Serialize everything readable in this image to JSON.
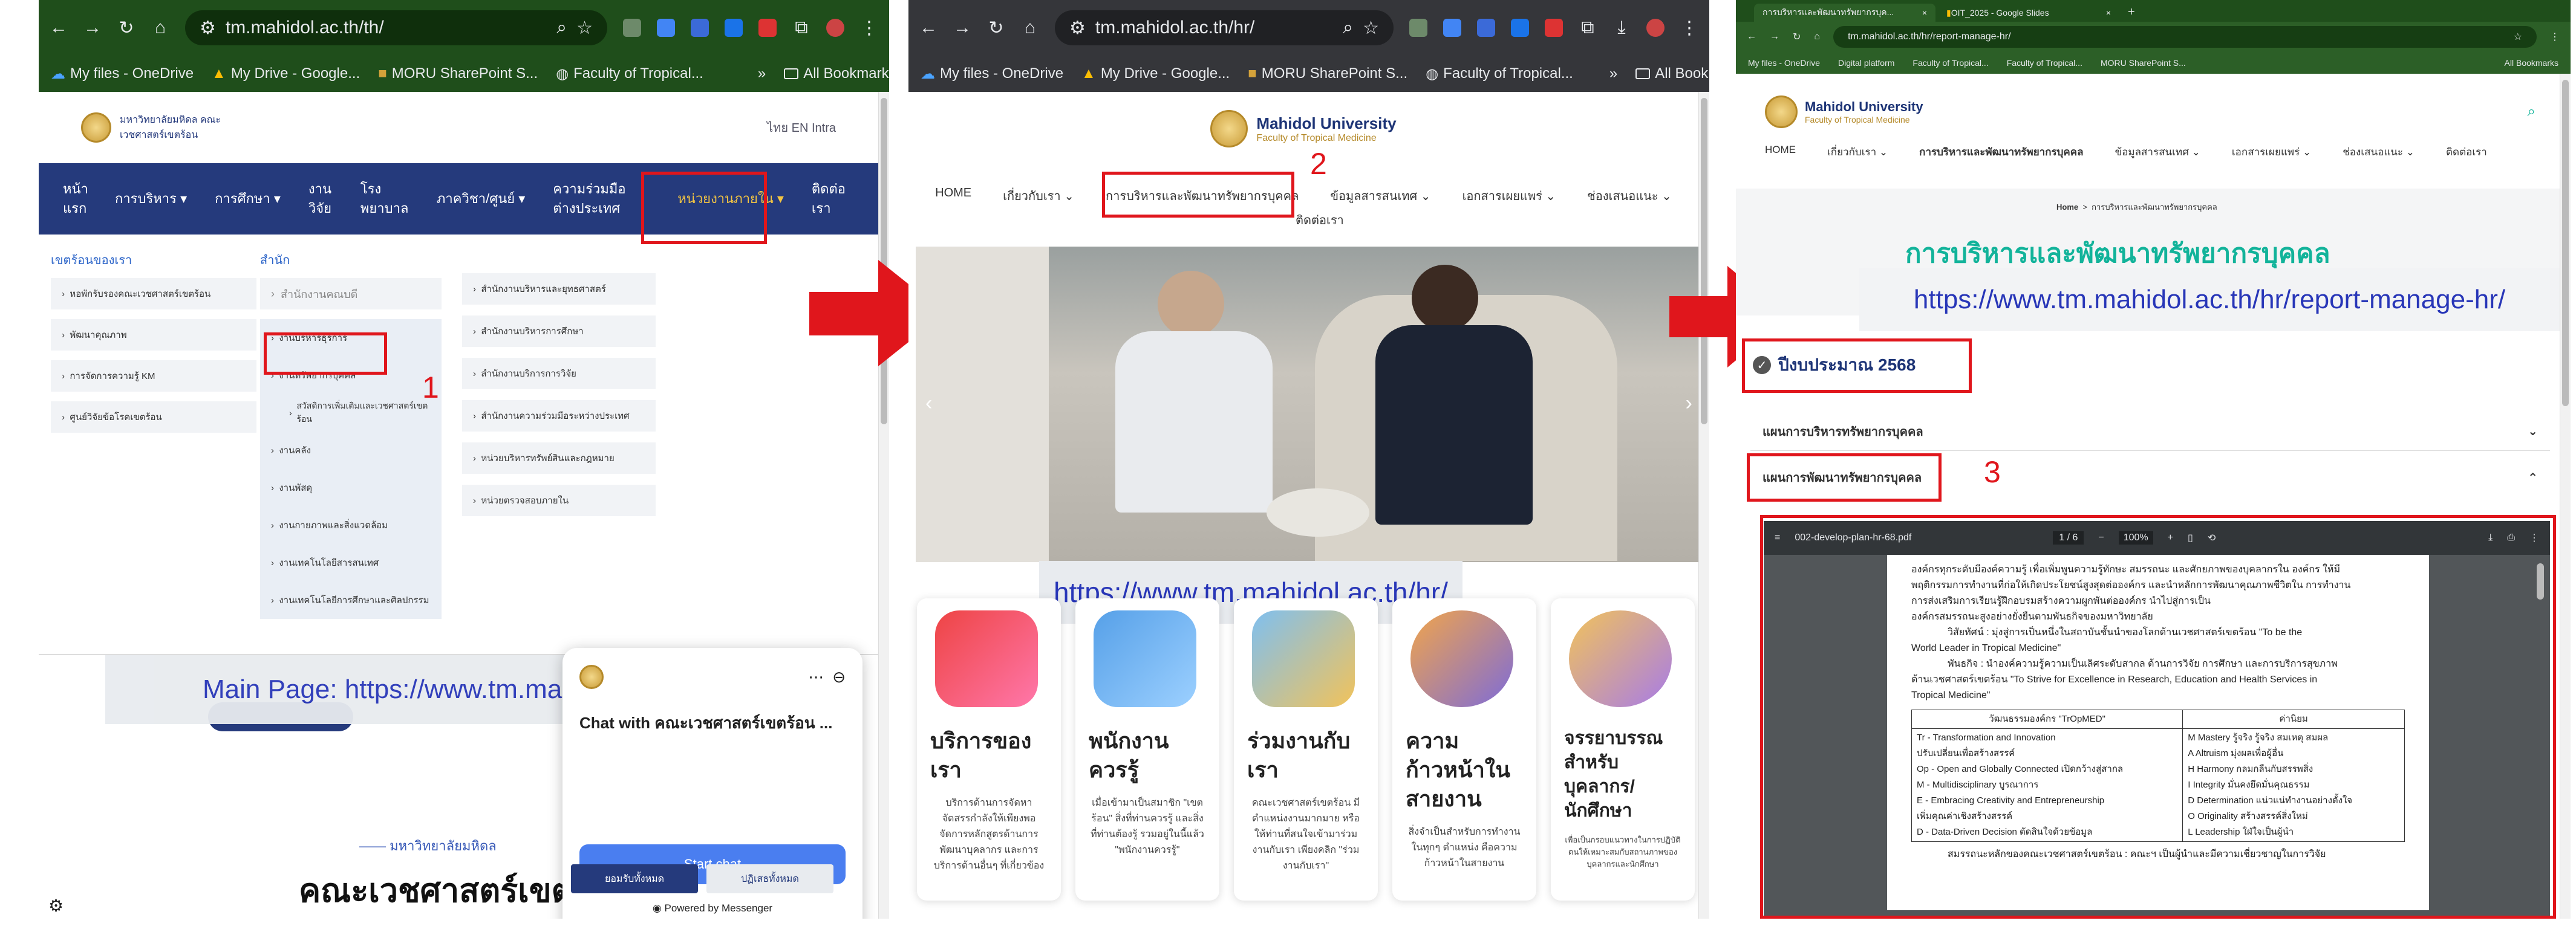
{
  "panel1": {
    "url": "tm.mahidol.ac.th/th/",
    "bookmarks": [
      "My files - OneDrive",
      "My Drive - Google...",
      "MORU SharePoint S...",
      "Faculty of Tropical...",
      "All Bookmarks"
    ],
    "logo_text": "มหาวิทยาลัยมหิดล  คณะเวชศาสตร์เขตร้อน",
    "lang": "ไทย  EN  Intra",
    "nav": [
      "หน้าแรก",
      "การบริหาร",
      "การศึกษา",
      "งานวิจัย",
      "โรงพยาบาล",
      "ภาควิชา/ศูนย์",
      "ความร่วมมือต่างประเทศ",
      "หน่วยงานภายใน",
      "ติดต่อเรา"
    ],
    "col1_title": "เขตร้อนของเรา",
    "col1": [
      "หอพักรับรองคณะเวชศาสตร์เขตร้อน",
      "พัฒนาคุณภาพ",
      "การจัดการความรู้ KM",
      "ศูนย์วิจัยข้อโรคเขตร้อน"
    ],
    "col2_title": "สำนัก",
    "col2_head": "สำนักงานคณบดี",
    "col2": [
      "งานบริหารธุรการ",
      "งานทรัพยากรบุคคล",
      "สวัสดิการเพิ่มเติมและเวชศาสตร์เขตร้อน",
      "งานคลัง",
      "งานพัสดุ",
      "งานกายภาพและสิ่งแวดล้อม",
      "งานเทคโนโลยีสารสนเทศ",
      "งานเทคโนโลยีการศึกษาและศิลปกรรม"
    ],
    "col3": [
      "สำนักงานบริหารและยุทธศาสตร์",
      "สำนักงานบริหารการศึกษา",
      "สำนักงานบริการการวิจัย",
      "สำนักงานความร่วมมือระหว่างประเทศ",
      "หน่วยบริหารทรัพย์สินและกฎหมาย",
      "หน่วยตรวจสอบภายใน"
    ],
    "step": "1",
    "chat_title": "Chat with คณะเวชศาสตร์เขตร้อน ...",
    "chat_button": "Start chat",
    "chat_powered": "Powered by Messenger",
    "url_note": "Main Page: https://www.tm.mahidol.ac.th/th/",
    "footer_small": "มหาวิทยาลัยมหิดล",
    "footer_big": "คณะเวชศาสตร์เขต",
    "cookie_accept": "ยอมรับทั้งหมด",
    "cookie_reject": "ปฏิเสธทั้งหมด"
  },
  "panel2": {
    "url": "tm.mahidol.ac.th/hr/",
    "bookmarks": [
      "My files - OneDrive",
      "My Drive - Google...",
      "MORU SharePoint S...",
      "Faculty of Tropical...",
      "All Bookmarks"
    ],
    "logo_title": "Mahidol University",
    "logo_sub": "Faculty of Tropical Medicine",
    "nav": [
      "HOME",
      "เกี่ยวกับเรา",
      "การบริหารและพัฒนาทรัพยากรบุคคล",
      "ข้อมูลสารสนเทศ",
      "เอกสารเผยแพร่",
      "ช่องเสนอแนะ"
    ],
    "nav_extra": "ติดต่อเรา",
    "step": "2",
    "url_note": "https://www.tm.mahidol.ac.th/hr/",
    "cards": [
      {
        "title": "บริการของเรา",
        "text": "บริการด้านการจัดหา จัดสรรกำลังให้เพียงพอ จัดการหลักสูตรด้านการพัฒนาบุคลากร และการบริการด้านอื่นๆ ที่เกี่ยวข้อง"
      },
      {
        "title": "พนักงานควรรู้",
        "text": "เมื่อเข้ามาเป็นสมาชิก \"เขตร้อน\" สิ่งที่ท่านควรรู้ และสิ่งที่ท่านต้องรู้ รวมอยู่ในนี้แล้ว \"พนักงานควรรู้\""
      },
      {
        "title": "ร่วมงานกับเรา",
        "text": "คณะเวชศาสตร์เขตร้อน มีตำแหน่งงานมากมาย หรือให้ท่านที่สนใจเข้ามาร่วมงานกับเรา เพียงคลิก \"ร่วมงานกับเรา\""
      },
      {
        "title": "ความก้าวหน้าในสายงาน",
        "text": "สิ่งจำเป็นสำหรับการทำงานในทุกๆ ตำแหน่ง คือความก้าวหน้าในสายงาน"
      },
      {
        "title": "จรรยาบรรณสำหรับบุคลากร/นักศึกษา",
        "text": "เพื่อเป็นกรอบแนวทางในการปฏิบัติตนให้เหมาะสมกับสถานภาพของบุคลากรและนักศึกษา"
      }
    ]
  },
  "panel3": {
    "tabs": [
      "การบริหารและพัฒนาทรัพยากรบุค...",
      "OIT_2025 - Google Slides"
    ],
    "url": "tm.mahidol.ac.th/hr/report-manage-hr/",
    "bookmarks": [
      "My files - OneDrive",
      "Digital platform",
      "Faculty of Tropical...",
      "Faculty of Tropical...",
      "MORU SharePoint S...",
      "All Bookmarks"
    ],
    "logo_title": "Mahidol University",
    "logo_sub": "Faculty of Tropical Medicine",
    "nav": [
      "HOME",
      "เกี่ยวกับเรา",
      "การบริหารและพัฒนาทรัพยากรบุคคล",
      "ข้อมูลสารสนเทศ",
      "เอกสารเผยแพร่",
      "ช่องเสนอแนะ",
      "ติดต่อเรา"
    ],
    "breadcrumb": [
      "Home",
      "การบริหารและพัฒนาทรัพยากรบุคคล"
    ],
    "page_title": "การบริหารและพัฒนาทรัพยากรบุคคล",
    "url_note": "https://www.tm.mahidol.ac.th/hr/report-manage-hr/",
    "fiscal_year": "ปีงบประมาณ 2568",
    "acc1": "แผนการบริหารทรัพยากรบุคคล",
    "acc2": "แผนการพัฒนาทรัพยากรบุคคล",
    "step": "3",
    "pdf_name": "002-develop-plan-hr-68.pdf",
    "pdf_page": "1  /  6",
    "pdf_zoom": "100%",
    "pdf_lines": [
      "องค์กรทุกระดับมีองค์ความรู้ เพื่อเพิ่มพูนความรู้ทักษะ สมรรถนะ และศักยภาพของบุคลากรใน องค์กร ให้มี",
      "พฤติกรรมการทำงานที่ก่อให้เกิดประโยชน์สูงสุดต่อองค์กร และนำหลักการพัฒนาคุณภาพชีวิตใน การทำงาน",
      "การส่งเสริมการเรียนรู้ฝึกอบรมสร้างความผูกพันต่อองค์กร นำไปสู่การเป็น",
      "องค์กรสมรรถนะสูงอย่างยั่งยืนตามพันธกิจของมหาวิทยาลัย",
      "วิสัยทัศน์ : มุ่งสู่การเป็นหนึ่งในสถาบันชั้นนำของโลกด้านเวชศาสตร์เขตร้อน \"To be the",
      "World Leader in Tropical Medicine\"",
      "พันธกิจ : นำองค์ความรู้ความเป็นเลิศระดับสากล ด้านการวิจัย การศึกษา และการบริการสุขภาพ",
      "ด้านเวชศาสตร์เขตร้อน \"To Strive for Excellence in Research, Education and Health Services in",
      "Tropical Medicine\""
    ],
    "table_head": [
      "วัฒนธรรมองค์กร \"TrOpMED\"",
      "ค่านิยม"
    ],
    "table_left": [
      "Tr -   Transformation and Innovation",
      "        ปรับเปลี่ยนเพื่อสร้างสรรค์",
      "Op -   Open and Globally Connected เปิดกว้างสู่สากล",
      "M -    Multidisciplinary บูรณาการ",
      "E -    Embracing Creativity and Entrepreneurship",
      "        เพิ่มคุณค่าเชิงสร้างสรรค์",
      "D -    Data-Driven Decision ตัดสินใจด้วยข้อมูล"
    ],
    "table_right": [
      "M  Mastery รู้จริง รู้จริง สมเหตุ สมผล",
      "A  Altruism มุ่งผลเพื่อผู้อื่น",
      "H  Harmony กลมกลืนกับสรรพสิ่ง",
      "I  Integrity มั่นคงยึดมั่นคุณธรรม",
      "D  Determination แน่วแน่ทำงานอย่างตั้งใจ",
      "O  Originality สร้างสรรค์สิ่งใหม่",
      "L  Leadership ใฝ่ใจเป็นผู้นำ"
    ],
    "pdf_footer": "สมรรถนะหลักของคณะเวชศาสตร์เขตร้อน : คณะฯ เป็นผู้นำและมีความเชี่ยวชาญในการวิจัย"
  },
  "colors": {
    "red": "#e0161c",
    "navy": "#253a7c",
    "green_title": "#12b39a",
    "link_blue": "#2836b8"
  }
}
